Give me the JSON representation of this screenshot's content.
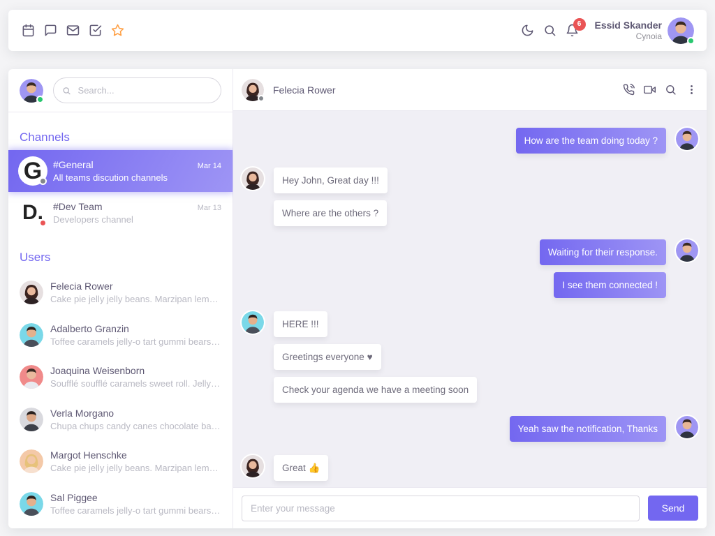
{
  "colors": {
    "primary": "#7367f0",
    "online": "#28c76f",
    "busy": "#ea5455",
    "offline": "#82868b",
    "star": "#ff9f43"
  },
  "navbar": {
    "icons": [
      "calendar-icon",
      "message-square-icon",
      "mail-icon",
      "check-square-icon",
      "star-icon"
    ],
    "notifications_count": "6",
    "user": {
      "name": "Essid Skander",
      "org": "Cynoia",
      "status": "online"
    }
  },
  "sidebar": {
    "search_placeholder": "Search...",
    "channels_title": "Channels",
    "channels": [
      {
        "letter": "G",
        "name": "#General",
        "preview": "All teams discution channels",
        "time": "Mar 14",
        "status": "offline",
        "active": true
      },
      {
        "letter": "D.",
        "name": "#Dev Team",
        "preview": "Developers channel",
        "time": "Mar 13",
        "status": "busy",
        "active": false
      }
    ],
    "users_title": "Users",
    "users": [
      {
        "name": "Felecia Rower",
        "preview": "Cake pie jelly jelly beans. Marzipan lemon drops halvah cake."
      },
      {
        "name": "Adalberto Granzin",
        "preview": "Toffee caramels jelly-o tart gummi bears cake."
      },
      {
        "name": "Joaquina Weisenborn",
        "preview": "Soufflé soufflé caramels sweet roll. Jelly lollipop sesame."
      },
      {
        "name": "Verla Morgano",
        "preview": "Chupa chups candy canes chocolate bar marshmallow."
      },
      {
        "name": "Margot Henschke",
        "preview": "Cake pie jelly jelly beans. Marzipan lemon drops halvah cake."
      },
      {
        "name": "Sal Piggee",
        "preview": "Toffee caramels jelly-o tart gummi bears cake."
      }
    ]
  },
  "chat": {
    "contact_name": "Felecia Rower",
    "groups": [
      {
        "side": "right",
        "messages": [
          "How are the team doing today ?"
        ]
      },
      {
        "side": "left",
        "messages": [
          "Hey John, Great day !!!",
          "Where are the others ?"
        ]
      },
      {
        "side": "right",
        "messages": [
          "Waiting for their response.",
          "I see them connected !"
        ]
      },
      {
        "side": "left",
        "messages": [
          "HERE !!!",
          "Greetings everyone ♥",
          "Check your agenda we have a meeting soon"
        ]
      },
      {
        "side": "right",
        "messages": [
          "Yeah saw the notification, Thanks"
        ]
      },
      {
        "side": "left",
        "messages": [
          "Great 👍"
        ]
      }
    ],
    "input_placeholder": "Enter your message",
    "send_label": "Send"
  }
}
